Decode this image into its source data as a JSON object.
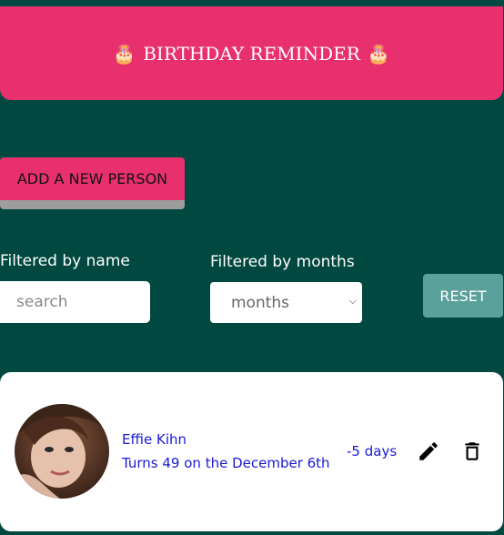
{
  "header": {
    "title": "BIRTHDAY REMINDER",
    "icon_left": "cake-icon",
    "icon_right": "cake-icon"
  },
  "actions": {
    "add_label": "ADD A NEW PERSON"
  },
  "filters": {
    "name_label": "Filtered by name",
    "search_placeholder": "search",
    "months_label": "Filtered by months",
    "months_selected": "months",
    "reset_label": "RESET"
  },
  "people": [
    {
      "name": "Effie Kihn",
      "turns_text": "Turns 49 on the December 6th",
      "days_text": "-5 days",
      "edit_icon": "pencil-icon",
      "delete_icon": "trash-icon"
    }
  ],
  "colors": {
    "background": "#014840",
    "accent": "#e8306f",
    "reset": "#5aa09b",
    "link_text": "#1a1ad4"
  }
}
